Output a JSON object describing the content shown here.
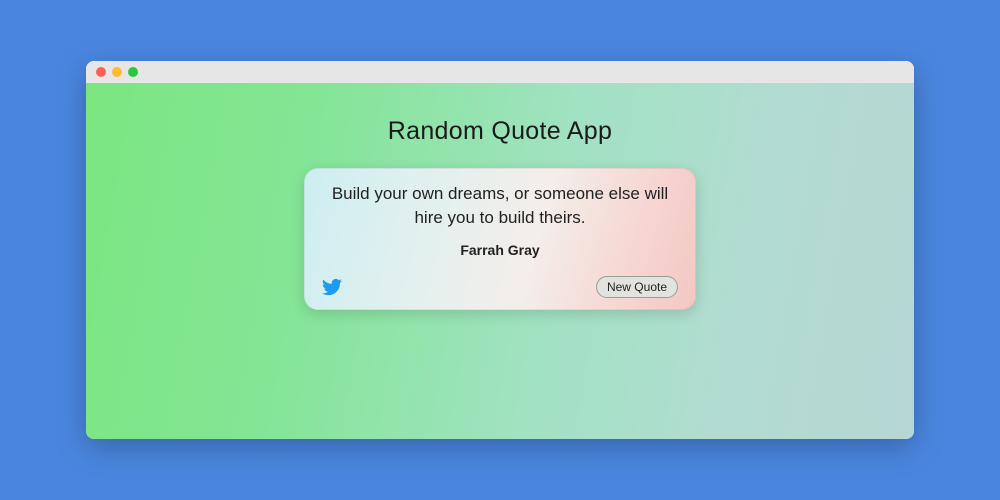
{
  "header": {
    "title": "Random Quote App"
  },
  "quote": {
    "text": "Build your own dreams, or someone else will hire you to build theirs.",
    "author": "Farrah Gray"
  },
  "actions": {
    "new_quote_label": "New Quote"
  },
  "icons": {
    "twitter": "twitter-icon"
  },
  "colors": {
    "page_bg": "#4a86e0",
    "gradient_start": "#7be680",
    "gradient_end": "#b6d6d3",
    "card_gradient_start": "#cdeef0",
    "card_gradient_end": "#f3c7c2",
    "twitter": "#1d9bf0"
  }
}
